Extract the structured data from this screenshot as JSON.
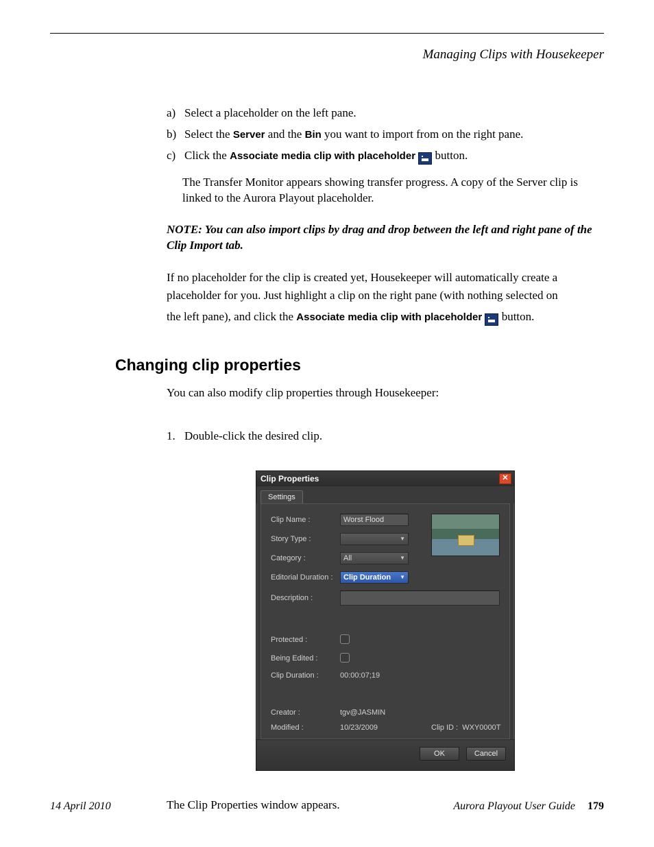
{
  "header": {
    "chapter": "Managing Clips with Housekeeper"
  },
  "steps_alpha": [
    {
      "marker": "a)",
      "text": "Select a placeholder on the left pane."
    },
    {
      "marker": "b)",
      "pre": "Select the ",
      "b1": "Server",
      "mid": " and the ",
      "b2": "Bin",
      "post": " you want to import from on the right pane."
    },
    {
      "marker": "c)",
      "pre": "Click the ",
      "ui": "Associate media clip with placeholder",
      "post": " button."
    }
  ],
  "sub_para": "The Transfer Monitor appears showing transfer progress. A copy of the Server clip is linked to the Aurora Playout placeholder.",
  "note": "NOTE:  You can also import clips by drag and drop between the left and right pane of the Clip Import tab.",
  "para_if1": "If no placeholder for the clip is created yet, Housekeeper will automatically create a placeholder for you. Just highlight a clip on the right pane (with nothing selected on",
  "para_if2_pre": "the left pane), and click the ",
  "para_if2_ui": "Associate media clip with placeholder",
  "para_if2_post": " button.",
  "section_title": "Changing clip properties",
  "section_intro": "You can also modify clip properties through Housekeeper:",
  "num_step": {
    "marker": "1.",
    "text": "Double-click the desired clip."
  },
  "dialog": {
    "title": "Clip Properties",
    "tab": "Settings",
    "labels": {
      "clip_name": "Clip Name :",
      "story_type": "Story Type :",
      "category": "Category :",
      "ed_dur": "Editorial Duration :",
      "description": "Description :",
      "protected": "Protected :",
      "being_edited": "Being Edited :",
      "clip_duration": "Clip Duration :",
      "creator": "Creator :",
      "modified": "Modified :",
      "clip_id_label": "Clip ID :"
    },
    "values": {
      "clip_name": "Worst Flood",
      "category": "All",
      "ed_dur": "Clip Duration",
      "clip_duration": "00:00:07;19",
      "creator": "tgv@JASMIN",
      "modified": "10/23/2009",
      "clip_id": "WXY0000T"
    },
    "buttons": {
      "ok": "OK",
      "cancel": "Cancel"
    }
  },
  "after_dialog": "The Clip Properties window appears.",
  "footer": {
    "date": "14  April  2010",
    "guide": "Aurora Playout User Guide",
    "page": "179"
  }
}
